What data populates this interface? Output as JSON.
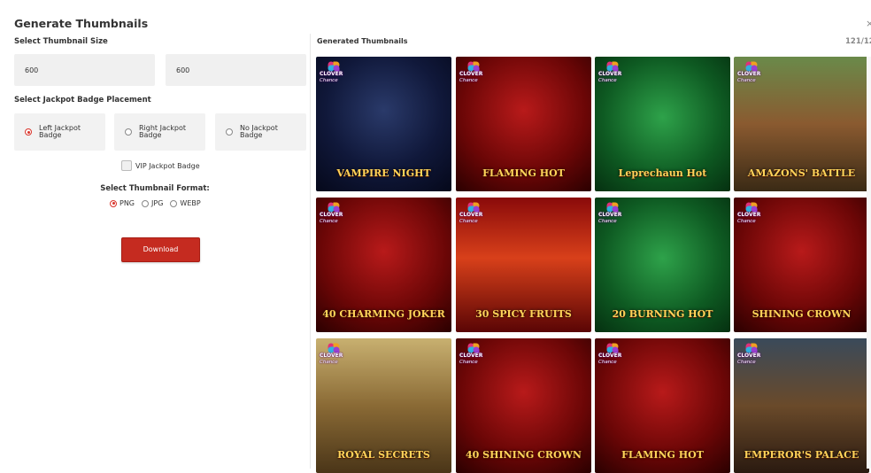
{
  "dialog": {
    "title": "Generate Thumbnails",
    "close": "×"
  },
  "left": {
    "size_label": "Select Thumbnail Size",
    "width_value": "600",
    "height_value": "600",
    "badge_label": "Select Jackpot Badge Placement",
    "badge_options": [
      {
        "label": "Left Jackpot Badge",
        "selected": true
      },
      {
        "label": "Right Jackpot Badge",
        "selected": false
      },
      {
        "label": "No Jackpot Badge",
        "selected": false
      }
    ],
    "vip_label": "VIP Jackpot Badge",
    "format_label": "Select Thumbnail Format:",
    "formats": [
      {
        "label": "PNG",
        "selected": true
      },
      {
        "label": "JPG",
        "selected": false
      },
      {
        "label": "WEBP",
        "selected": false
      }
    ],
    "download_label": "Download"
  },
  "right": {
    "title": "Generated Thumbnails",
    "count": "121/12"
  },
  "colors": {
    "accent": "#c52b20",
    "radio_active": "#d9342b"
  },
  "badge_overlay": {
    "line1": "CLOVER",
    "line2": "Chance"
  },
  "thumbnails": [
    {
      "name": "VAMPIRE NIGHT",
      "theme": "night"
    },
    {
      "name": "FLAMING HOT",
      "theme": "red"
    },
    {
      "name": "Leprechaun Hot",
      "theme": "green"
    },
    {
      "name": "AMAZONS' BATTLE",
      "theme": "jungle"
    },
    {
      "name": "40 CHARMING JOKER",
      "theme": "red"
    },
    {
      "name": "30 SPICY FRUITS",
      "theme": "fire"
    },
    {
      "name": "20 BURNING HOT",
      "theme": "green"
    },
    {
      "name": "SHINING CROWN",
      "theme": "red"
    },
    {
      "name": "ROYAL SECRETS",
      "theme": "gold"
    },
    {
      "name": "40 SHINING CROWN",
      "theme": "red"
    },
    {
      "name": "FLAMING HOT",
      "theme": "red"
    },
    {
      "name": "EMPEROR'S PALACE",
      "theme": "palace"
    }
  ]
}
